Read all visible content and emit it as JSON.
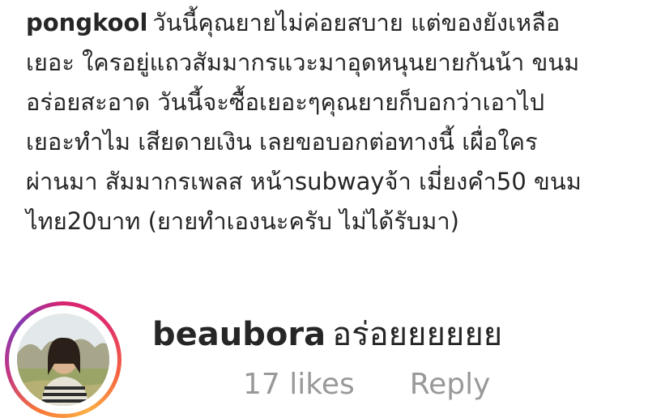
{
  "post": {
    "username": "pongkool",
    "caption_lines": [
      "วันนี้คุณยายไม่ค่อยสบาย แต่ของยังเหลือ",
      "เยอะ ใครอยู่แถวสัมมากรแวะมาอุดหนุนยายกันน้า ขนม",
      "อร่อยสะอาด วันนี้จะซื้อเยอะๆคุณยายก็บอกว่าเอาไป",
      "เยอะทำไม เสียดายเงิน เลยขอบอกต่อทางนี้ เผื่อใคร",
      "ผ่านมา สัมมากรเพลส หน้าsubwayจ้า เมี่ยงคำ50 ขนม",
      "ไทย20บาท (ยายทำเองนะครับ ไม่ได้รับมา)"
    ]
  },
  "comment": {
    "username": "beaubora",
    "text": "อร่อยยยยยย",
    "likes": "17 likes",
    "reply_label": "Reply",
    "avatar_icon": "user-avatar-icon",
    "story_ring_colors": [
      "#d8236f",
      "#f56040",
      "#fcaf45",
      "#833ab4"
    ]
  }
}
